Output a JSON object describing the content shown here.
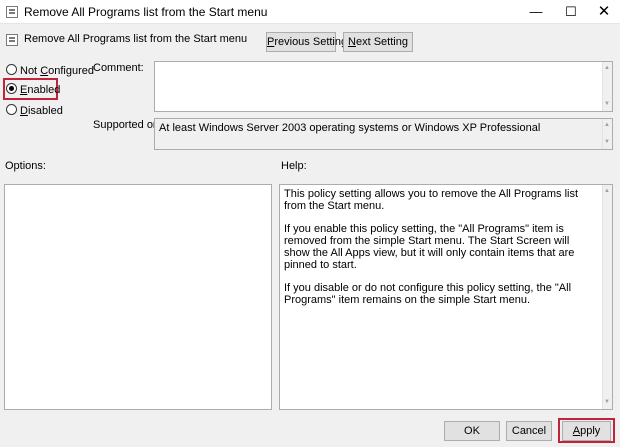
{
  "window": {
    "title": "Remove All Programs list from the Start menu"
  },
  "header": {
    "policy_name": "Remove All Programs list from the Start menu",
    "prev_button": "Previous Setting",
    "next_button": "Next Setting"
  },
  "state_options": [
    {
      "label": "Not Configured",
      "checked": false
    },
    {
      "label": "Enabled",
      "checked": true
    },
    {
      "label": "Disabled",
      "checked": false
    }
  ],
  "comment": {
    "label": "Comment:",
    "value": ""
  },
  "supported_on": {
    "label": "Supported on:",
    "value": "At least Windows Server 2003 operating systems or Windows XP Professional"
  },
  "options": {
    "label": "Options:"
  },
  "help": {
    "label": "Help:",
    "paragraphs": [
      "This policy setting allows you to remove the All Programs list from the Start menu.",
      "If you enable this policy setting, the \"All Programs\" item is removed from the simple Start menu.  The Start Screen will show the All Apps view, but it will only contain items that are pinned to start.",
      "If you disable or do not configure this policy setting, the \"All Programs\" item remains on the simple Start menu."
    ]
  },
  "footer": {
    "ok": "OK",
    "cancel": "Cancel",
    "apply": "Apply"
  },
  "colors": {
    "highlight": "#c0243a"
  }
}
